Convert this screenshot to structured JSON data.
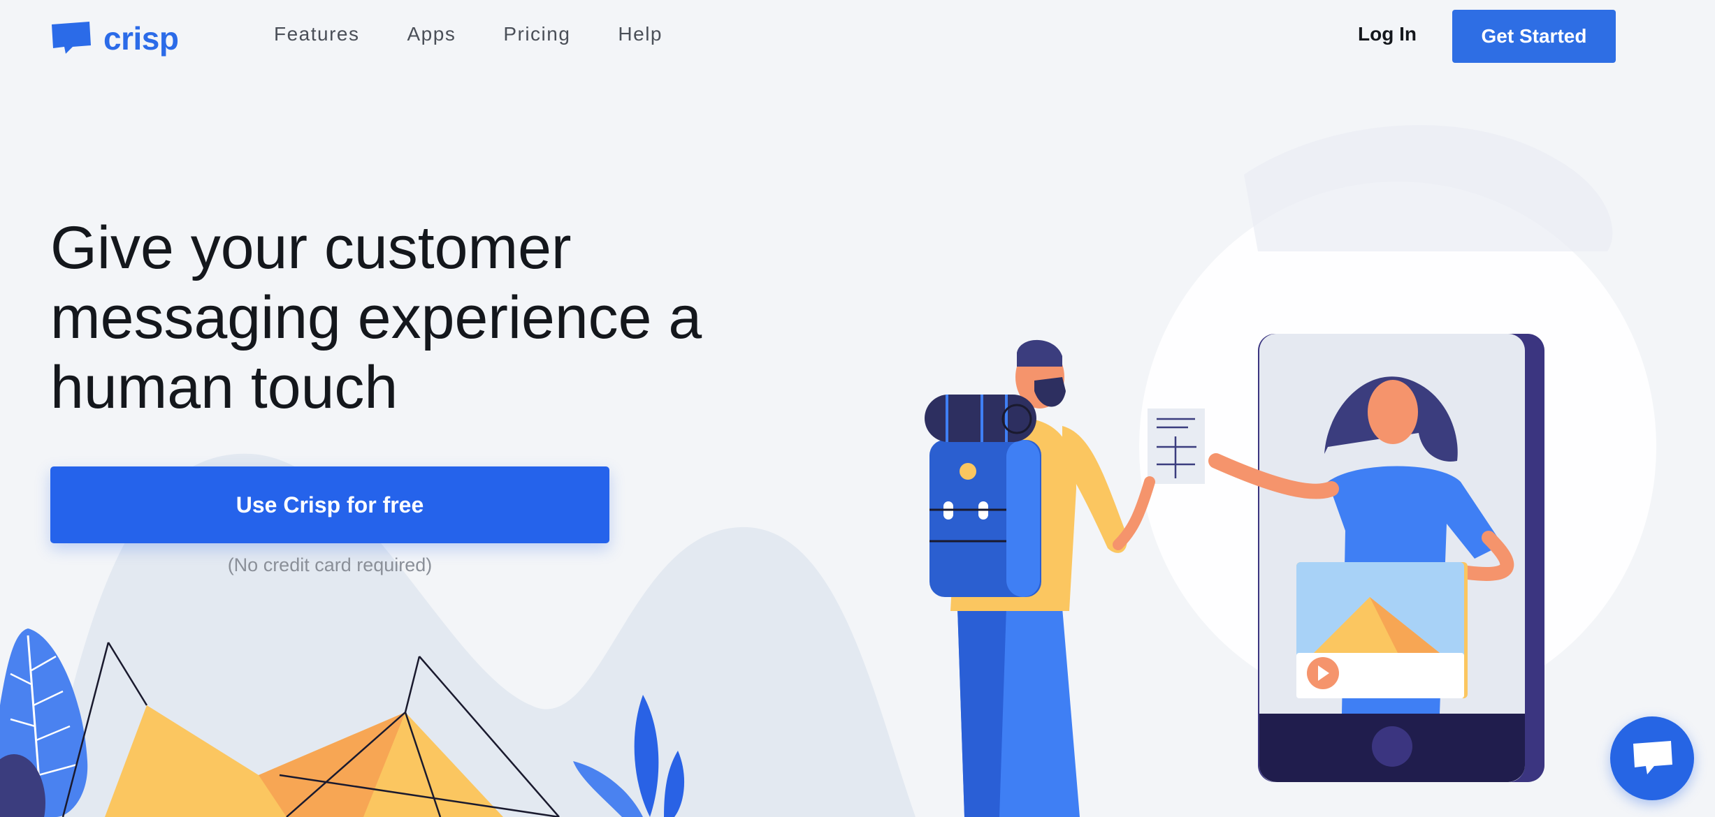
{
  "brand": {
    "name": "crisp",
    "logo_icon": "chat-bubble-icon",
    "accent": "#2e6ee4"
  },
  "nav": {
    "items": [
      {
        "label": "Features"
      },
      {
        "label": "Apps"
      },
      {
        "label": "Pricing"
      },
      {
        "label": "Help"
      }
    ]
  },
  "header": {
    "login_label": "Log In",
    "get_started_label": "Get Started"
  },
  "hero": {
    "headline": "Give your customer messaging experience a human touch",
    "cta_label": "Use Crisp for free",
    "cta_note": "(No credit card required)"
  },
  "chat_widget": {
    "icon": "chat-bubble-icon",
    "color": "#2665e4"
  }
}
